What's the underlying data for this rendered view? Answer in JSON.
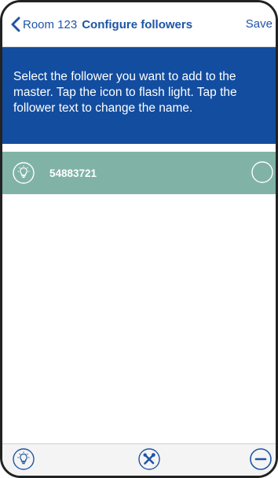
{
  "navbar": {
    "back_label": "Room 123",
    "title": "Configure followers",
    "save_label": "Save"
  },
  "banner": {
    "text": "Select the follower you want to add to the master. Tap the icon to flash light. Tap the follower text to change the name."
  },
  "followers": [
    {
      "name": "54883721",
      "icon": "lightbulb-icon",
      "selected": false
    }
  ],
  "toolbar": {
    "icons": [
      "lightbulb-icon",
      "tools-icon",
      "remove-icon"
    ]
  },
  "colors": {
    "accent": "#1e55a6",
    "banner_bg": "#124da0",
    "item_bg": "#80b3a6"
  }
}
